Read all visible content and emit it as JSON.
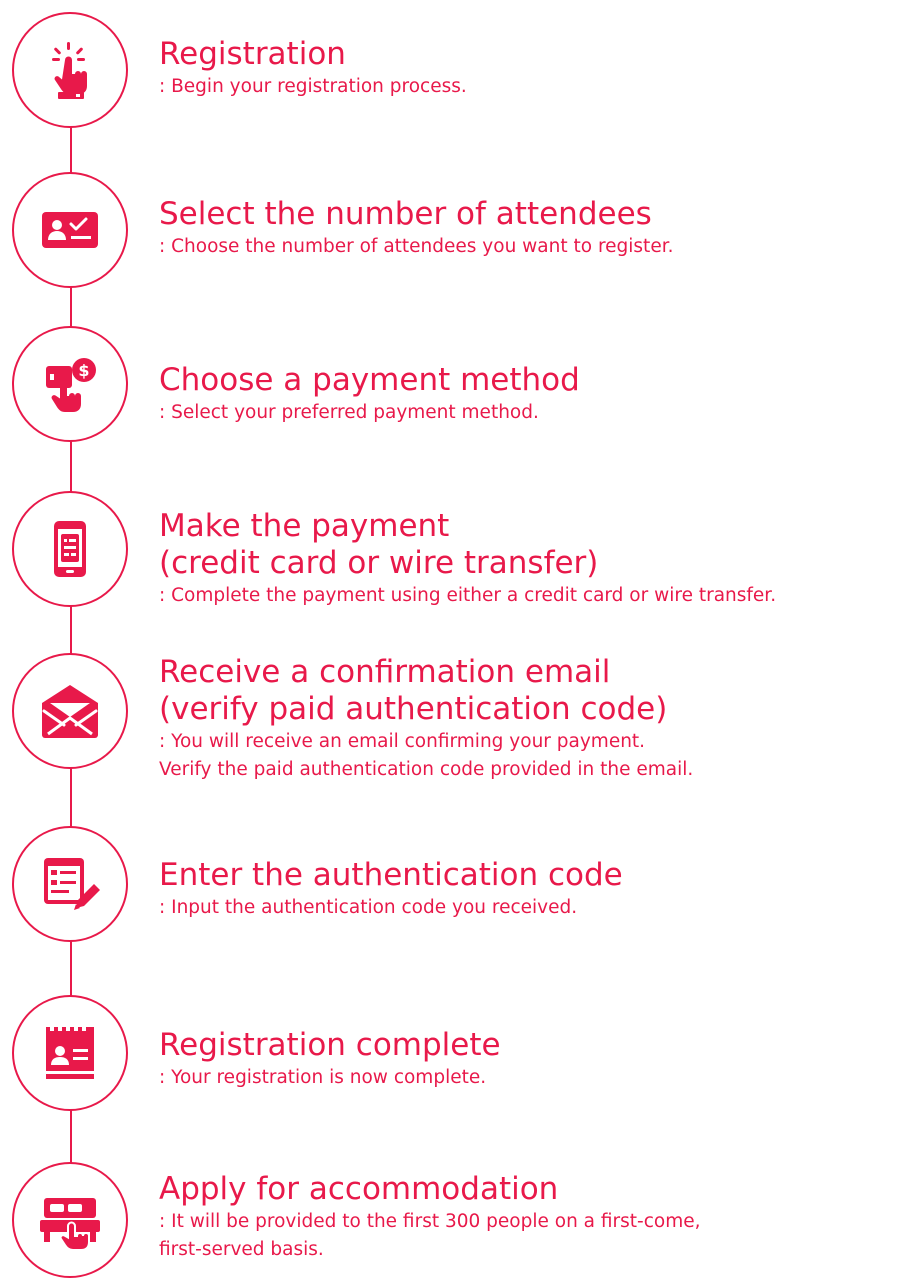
{
  "accent_color": "#e8194a",
  "steps": [
    {
      "icon": "tap-hand-icon",
      "title": "Registration",
      "description": ": Begin your registration process."
    },
    {
      "icon": "id-card-check-icon",
      "title": "Select the number of attendees",
      "description": ": Choose the number of attendees you want to register."
    },
    {
      "icon": "mobile-payment-icon",
      "title": "Choose a payment method",
      "description": ": Select your preferred payment method."
    },
    {
      "icon": "mobile-invoice-icon",
      "title": "Make the payment\n(credit card or wire transfer)",
      "description": ": Complete the payment using either a credit card or wire transfer."
    },
    {
      "icon": "open-envelope-icon",
      "title": "Receive a confirmation email\n(verify paid authentication code)",
      "description": ": You will receive an email confirming your payment.\n  Verify the paid authentication code provided in the email."
    },
    {
      "icon": "form-edit-icon",
      "title": "Enter the authentication code",
      "description": ": Input the authentication code you received."
    },
    {
      "icon": "ticket-badge-icon",
      "title": "Registration complete",
      "description": ": Your registration is now complete."
    },
    {
      "icon": "hotel-bed-icon",
      "title": "Apply for accommodation",
      "description": ": It will be provided to the first 300 people on a first-come,\n  first-served basis."
    }
  ]
}
